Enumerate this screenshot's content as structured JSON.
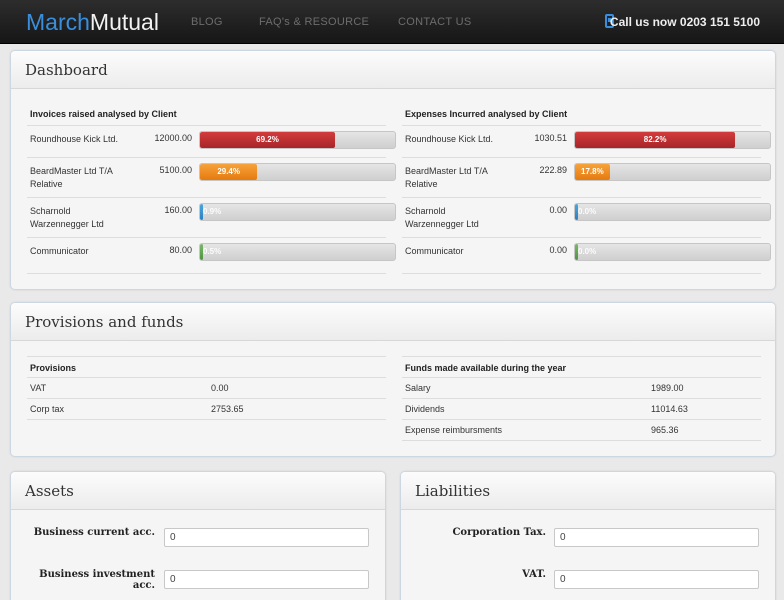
{
  "header": {
    "logo_part1": "March",
    "logo_part2": "Mutual",
    "nav": [
      "BLOG",
      "FAQ's & RESOURCE",
      "CONTACT US"
    ],
    "phone_text": "Call us now 0203 151 5100",
    "icons": {
      "phone": "mobile-phone-icon"
    },
    "colors": {
      "accent": "#3a8fdc",
      "bar": "#1e1e1e"
    }
  },
  "dashboard": {
    "title": "Dashboard",
    "invoices": {
      "heading": "Invoices raised analysed by Client",
      "rows": [
        {
          "client": "Roundhouse Kick Ltd.",
          "amount": "12000.00",
          "percent_label": "69.2%",
          "fraction": 0.692,
          "color": "red"
        },
        {
          "client": "BeardMaster Ltd T/A Relative",
          "amount": "5100.00",
          "percent_label": "29.4%",
          "fraction": 0.294,
          "color": "orange"
        },
        {
          "client": "Scharnold Warzennegger Ltd",
          "amount": "160.00",
          "percent_label": "0.9%",
          "fraction": 0.009,
          "color": "blue"
        },
        {
          "client": "Communicator",
          "amount": "80.00",
          "percent_label": "0.5%",
          "fraction": 0.005,
          "color": "green"
        }
      ]
    },
    "expenses": {
      "heading": "Expenses Incurred analysed by Client",
      "rows": [
        {
          "client": "Roundhouse Kick Ltd.",
          "amount": "1030.51",
          "percent_label": "82.2%",
          "fraction": 0.822,
          "color": "red"
        },
        {
          "client": "BeardMaster Ltd T/A Relative",
          "amount": "222.89",
          "percent_label": "17.8%",
          "fraction": 0.178,
          "color": "orange"
        },
        {
          "client": "Scharnold Warzennegger Ltd",
          "amount": "0.00",
          "percent_label": "0.0%",
          "fraction": 0.0,
          "color": "blue"
        },
        {
          "client": "Communicator",
          "amount": "0.00",
          "percent_label": "0.0%",
          "fraction": 0.0,
          "color": "green"
        }
      ]
    }
  },
  "provisions_funds": {
    "title": "Provisions and funds",
    "provisions": {
      "heading": "Provisions",
      "rows": [
        {
          "label": "VAT",
          "value": "0.00"
        },
        {
          "label": "Corp tax",
          "value": "2753.65"
        }
      ]
    },
    "funds": {
      "heading": "Funds made available during the year",
      "rows": [
        {
          "label": "Salary",
          "value": "1989.00"
        },
        {
          "label": "Dividends",
          "value": "11014.63"
        },
        {
          "label": "Expense reimbursments",
          "value": "965.36"
        }
      ]
    }
  },
  "assets": {
    "title": "Assets",
    "fields": [
      {
        "label": "Business current acc.",
        "value": "0"
      },
      {
        "label": "Business investment acc.",
        "value": "0"
      }
    ]
  },
  "liabilities": {
    "title": "Liabilities",
    "fields": [
      {
        "label": "Corporation Tax.",
        "value": "0"
      },
      {
        "label": "VAT.",
        "value": "0"
      }
    ]
  }
}
